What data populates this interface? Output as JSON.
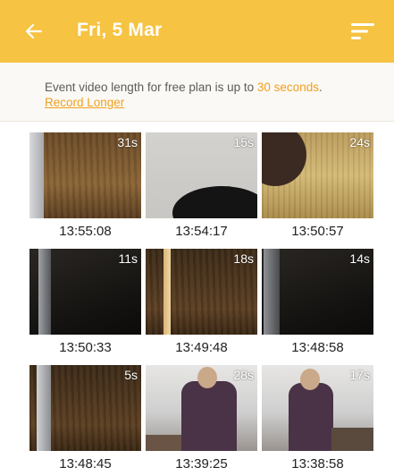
{
  "header": {
    "title": "Fri, 5 Mar",
    "back_icon": "arrow-left-icon",
    "filter_icon": "sort-filter-icon",
    "bg_color": "#f6c342"
  },
  "notice": {
    "text_before": "Event video length for free plan is up to ",
    "highlight": "30 seconds",
    "text_after": ".",
    "link": "Record Longer",
    "accent_color": "#f0a020"
  },
  "videos": [
    {
      "duration": "31s",
      "time": "13:55:08"
    },
    {
      "duration": "15s",
      "time": "13:54:17"
    },
    {
      "duration": "24s",
      "time": "13:50:57"
    },
    {
      "duration": "11s",
      "time": "13:50:33"
    },
    {
      "duration": "18s",
      "time": "13:49:48"
    },
    {
      "duration": "14s",
      "time": "13:48:58"
    },
    {
      "duration": "5s",
      "time": "13:48:45"
    },
    {
      "duration": "28s",
      "time": "13:39:25"
    },
    {
      "duration": "17s",
      "time": "13:38:58"
    }
  ]
}
